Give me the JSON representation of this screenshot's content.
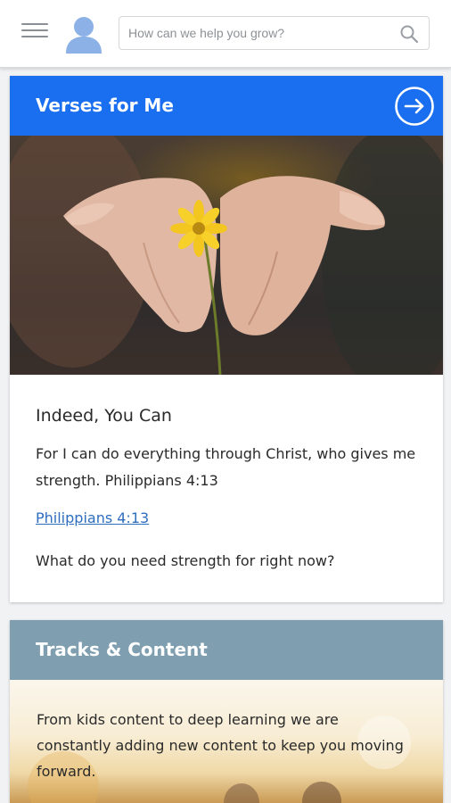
{
  "header": {
    "search_placeholder": "How can we help you grow?"
  },
  "verses_card": {
    "title": "Verses for Me",
    "accent_color": "#1a6ef0",
    "image_alt": "hands holding yellow flower",
    "verse_title": "Indeed, You Can",
    "verse_text": "For I can do everything through Christ, who gives me strength. Philippians 4:13",
    "verse_link": "Philippians 4:13",
    "question": "What do you need strength for right now?"
  },
  "tracks_card": {
    "title": "Tracks & Content",
    "header_color": "#7f9fb0",
    "description": "From kids content to deep learning we are constantly adding new content to keep you moving forward."
  }
}
